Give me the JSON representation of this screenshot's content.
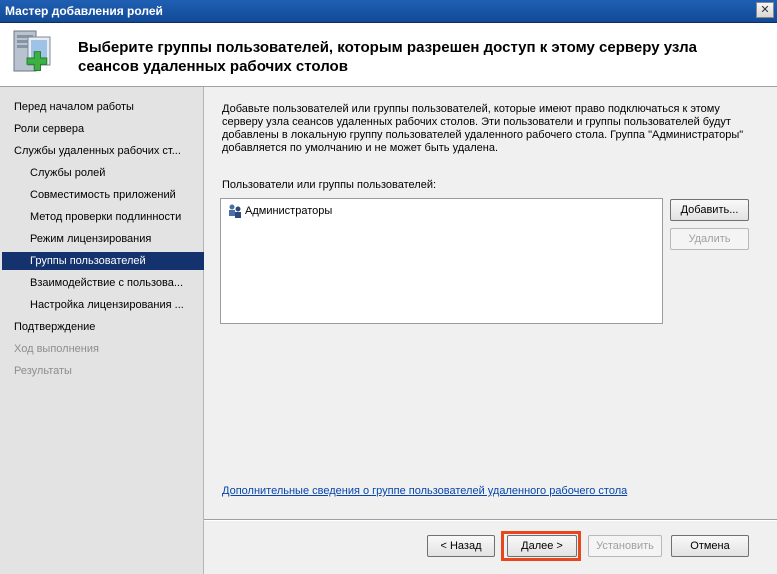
{
  "window": {
    "title": "Мастер добавления ролей",
    "close_label": "✕"
  },
  "header": {
    "heading": "Выберите группы пользователей, которым разрешен доступ к этому серверу узла сеансов удаленных рабочих столов"
  },
  "sidebar": {
    "items": [
      {
        "label": "Перед началом работы",
        "state": "normal"
      },
      {
        "label": "Роли сервера",
        "state": "normal"
      },
      {
        "label": "Службы удаленных рабочих ст...",
        "state": "normal"
      },
      {
        "label": "Службы ролей",
        "state": "normal"
      },
      {
        "label": "Совместимость приложений",
        "state": "normal"
      },
      {
        "label": "Метод проверки подлинности",
        "state": "normal"
      },
      {
        "label": "Режим лицензирования",
        "state": "normal"
      },
      {
        "label": "Группы пользователей",
        "state": "selected"
      },
      {
        "label": "Взаимодействие с пользова...",
        "state": "normal"
      },
      {
        "label": "Настройка лицензирования ...",
        "state": "normal"
      },
      {
        "label": "Подтверждение",
        "state": "normal"
      },
      {
        "label": "Ход выполнения",
        "state": "disabled"
      },
      {
        "label": "Результаты",
        "state": "disabled"
      }
    ]
  },
  "main": {
    "description": "Добавьте пользователей или группы пользователей, которые имеют право подключаться к этому серверу узла сеансов удаленных рабочих столов. Эти пользователи и группы пользователей будут добавлены в локальную группу пользователей удаленного рабочего стола. Группа \"Администраторы\" добавляется по умолчанию и не может быть удалена.",
    "list_label": "Пользователи или группы пользователей:",
    "list_items": [
      "Администраторы"
    ],
    "add_button": "Добавить...",
    "remove_button": "Удалить",
    "more_info_link": "Дополнительные сведения о группе пользователей удаленного рабочего стола"
  },
  "footer": {
    "back_button": "< Назад",
    "next_button": "Далее >",
    "install_button": "Установить",
    "cancel_button": "Отмена"
  },
  "colors": {
    "title_bar": "#1f5fb4",
    "selected_nav": "#14336e",
    "highlight_box": "#e8461c",
    "link": "#0645ad"
  }
}
